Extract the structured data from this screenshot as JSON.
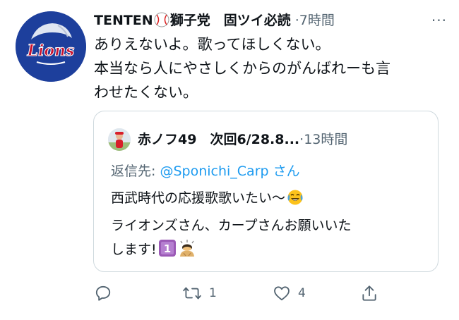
{
  "tweet": {
    "author_name_prefix": "TENTEN",
    "author_name_suffix": "獅子党　固ツイ必読",
    "separator": "·",
    "time": "7時間",
    "more_glyph": "···",
    "avatar_text": "Lions",
    "text_lines": [
      "ありえないよ。歌ってほしくない。",
      "本当なら人にやさしくからのがんばれーも言",
      "わせたくない。"
    ]
  },
  "quote": {
    "author_name": "赤ノフ49　次回6/28.8...",
    "separator": "·",
    "time": "13時間",
    "reply_label": "返信先:",
    "reply_handle": "@Sponichi_Carp",
    "reply_suffix": "さん",
    "text_lines": [
      "西武時代の応援歌歌いたい〜",
      "ライオンズさん、カープさんお願いいた",
      "します!"
    ]
  },
  "actions": {
    "reply_count": "",
    "retweet_count": "1",
    "like_count": "4"
  },
  "colors": {
    "text": "#0f1419",
    "secondary": "#536471",
    "link": "#1d9bf0",
    "border": "#cfd9de",
    "avatar_bg": "#1d3f9c",
    "lions_red": "#c8102e"
  }
}
